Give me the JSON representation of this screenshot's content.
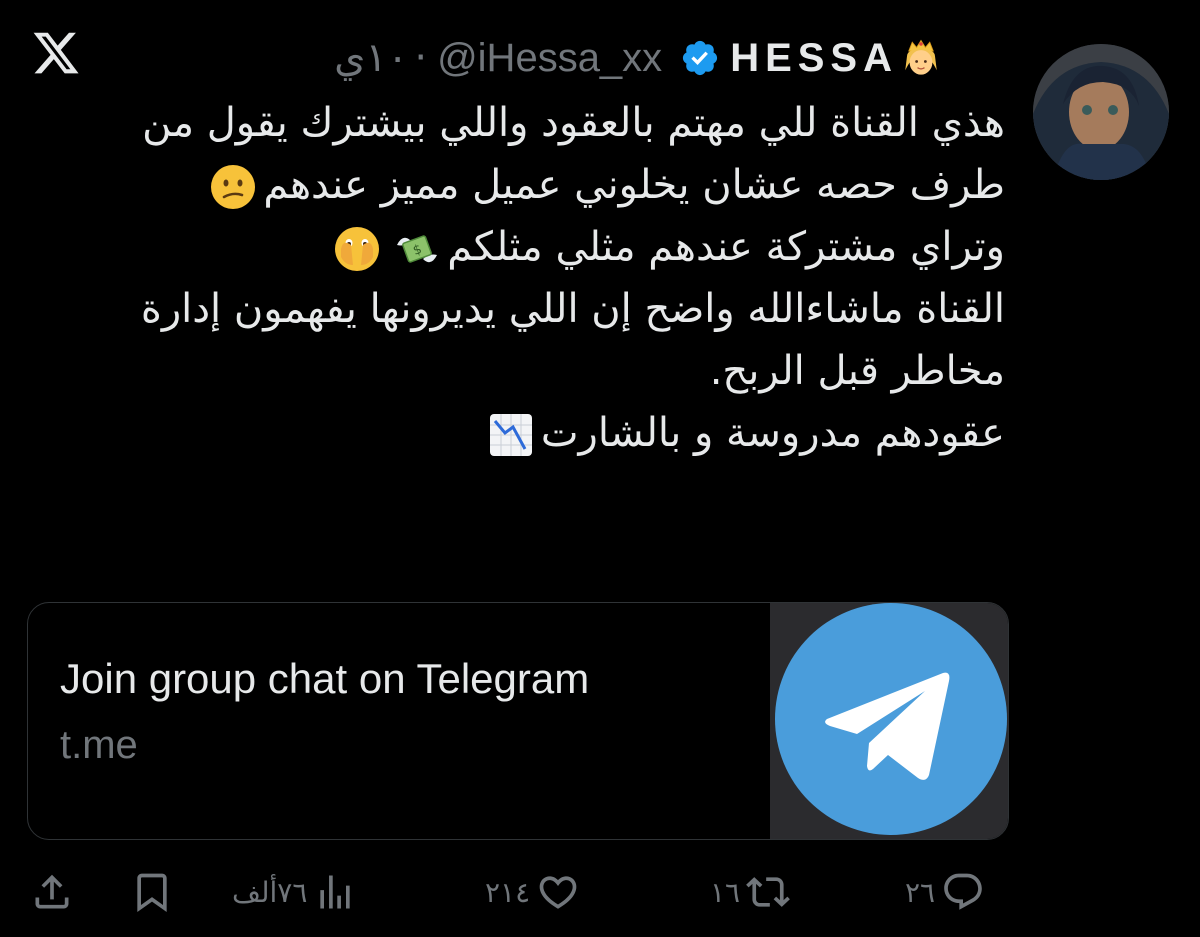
{
  "app": {
    "logo_icon": "x-logo-icon"
  },
  "tweet": {
    "author": {
      "display_name": "HESSA",
      "handle": "@iHessa_xx",
      "verified": true,
      "avatar_icon": "profile-photo"
    },
    "separator": "·",
    "time": "١٠ي",
    "lines": [
      "هذي القناة للي مهتم بالعقود واللي بيشترك يقول من",
      "طرف حصه عشان يخلوني عميل مميز عندهم",
      "وتراي مشتركة عندهم مثلي مثلكم",
      "القناة ماشاءالله واضح إن اللي يديرونها يفهمون إدارة",
      "مخاطر قبل الربح.",
      "عقودهم مدروسة و بالشارت"
    ]
  },
  "card": {
    "title": "Join group chat on Telegram",
    "domain": "t.me",
    "thumbnail_icon": "telegram-logo-icon"
  },
  "actions": {
    "replies": "٢٦",
    "reposts": "١٦",
    "likes": "٢١٤",
    "views": "٧٦ألف"
  },
  "colors": {
    "background": "#000000",
    "text": "#e7e9ea",
    "muted": "#71767b",
    "verified": "#1d9bf0",
    "telegram": "#4a9ddb"
  }
}
